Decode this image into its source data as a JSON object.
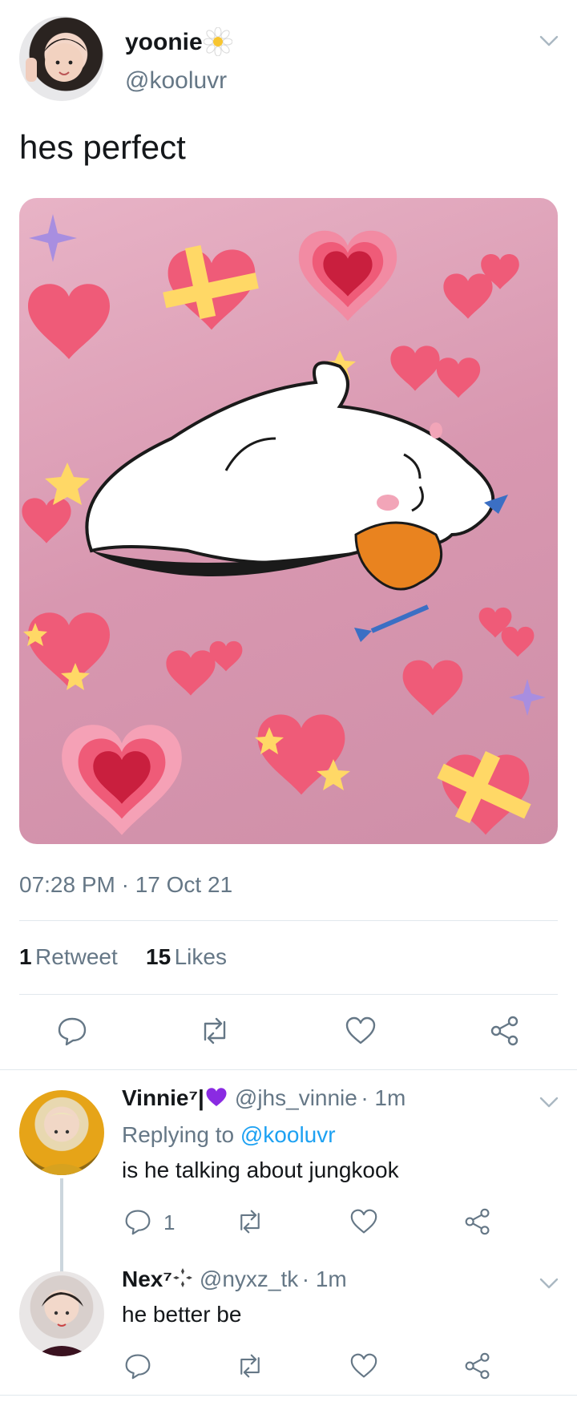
{
  "tweet": {
    "author_name": "yoonie",
    "author_badge": "flower-emoji",
    "author_handle": "@kooluvr",
    "text": "hes perfect",
    "timestamp": "07:28 PM · 17 Oct 21",
    "retweet_count": "1",
    "retweet_label": "Retweet",
    "like_count": "15",
    "like_label": "Likes"
  },
  "replies": [
    {
      "name": "Vinnie⁷|",
      "name_emoji": "purple-heart",
      "handle": "@jhs_vinnie",
      "time": "· 1m",
      "replying_prefix": "Replying to",
      "replying_to": "@kooluvr",
      "text": "is he talking about jungkook",
      "reply_count": "1"
    },
    {
      "name": "Nex⁷",
      "name_emoji": "sparkle-cluster",
      "handle": "@nyxz_tk",
      "time": "· 1m",
      "text": "he better be",
      "reply_count": ""
    }
  ],
  "colors": {
    "link": "#1da1f2",
    "secondary_text": "#657786",
    "heart_pink": "#ef5b78",
    "image_background": "#dba0b6"
  },
  "icons": [
    "chevron-down-icon",
    "reply-icon",
    "retweet-icon",
    "like-icon",
    "share-icon"
  ]
}
